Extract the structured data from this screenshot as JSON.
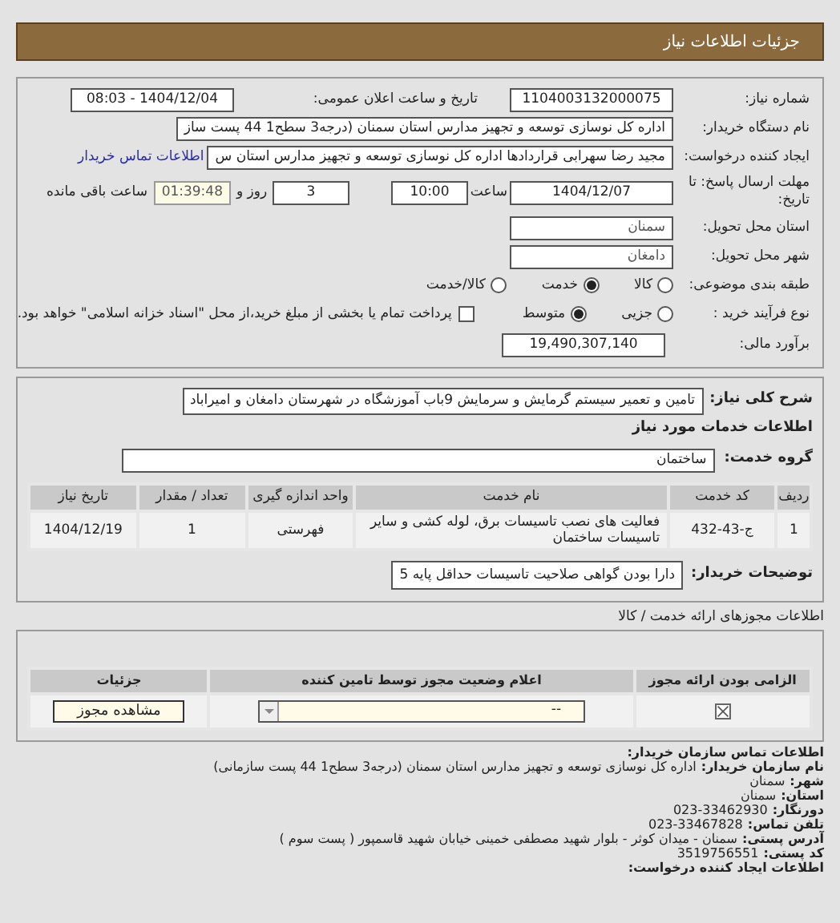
{
  "header": {
    "title": "جزئیات اطلاعات نیاز"
  },
  "summary": {
    "need_number": {
      "label": "شماره نیاز:",
      "value": "1104003132000075"
    },
    "announce": {
      "label": "تاریخ و ساعت اعلان عمومی:",
      "value": "1404/12/04 - 08:03"
    },
    "buyer": {
      "label": "نام دستگاه خریدار:",
      "value": "اداره کل نوسازی   توسعه و تجهیز مدارس استان سمنان (درجه3  سطح1  44 پست ساز"
    },
    "creator": {
      "label": "ایجاد کننده درخواست:",
      "value": "مجید رضا سهرابی قراردادها اداره کل نوسازی   توسعه و تجهیز مدارس استان س",
      "link": "اطلاعات تماس خریدار"
    },
    "deadline": {
      "label": "مهلت ارسال پاسخ: تا تاریخ:",
      "date": "1404/12/07",
      "time_label": "ساعت",
      "time": "10:00",
      "days": "3",
      "days_label": "روز و",
      "remaining": "01:39:48",
      "remaining_label": "ساعت باقی مانده"
    },
    "province": {
      "label": "استان محل تحویل:",
      "value": "سمنان"
    },
    "city": {
      "label": "شهر محل تحویل:",
      "value": "دامغان"
    },
    "category": {
      "label": "طبقه بندی موضوعی:",
      "options": [
        {
          "label": "کالا",
          "selected": false
        },
        {
          "label": "خدمت",
          "selected": true
        },
        {
          "label": "کالا/خدمت",
          "selected": false
        }
      ]
    },
    "purchase_type": {
      "label": "نوع فرآیند خرید :",
      "options": [
        {
          "label": "جزیی",
          "selected": false
        },
        {
          "label": "متوسط",
          "selected": true
        }
      ],
      "treasury": {
        "checked": false,
        "text": "پرداخت تمام یا بخشی از مبلغ خرید،از محل \"اسناد خزانه اسلامی\" خواهد بود."
      }
    },
    "budget": {
      "label": "برآورد مالی:",
      "value": "19,490,307,140"
    }
  },
  "needs": {
    "description": {
      "label": "شرح کلی نیاز:",
      "value": "تامین و تعمیر سیستم گرمایش و سرمایش 9باب آموزشگاه در شهرستان دامغان و امیراباد"
    },
    "services_title": "اطلاعات خدمات مورد نیاز",
    "service_group": {
      "label": "گروه خدمت:",
      "value": "ساختمان"
    },
    "table": {
      "columns": [
        "ردیف",
        "کد خدمت",
        "نام خدمت",
        "واحد اندازه گیری",
        "تعداد / مقدار",
        "تاریخ نیاز"
      ],
      "rows": [
        [
          "1",
          "ج-43-432",
          "فعالیت های نصب تاسیسات برق، لوله کشی و سایر تاسیسات ساختمان",
          "فهرستی",
          "1",
          "1404/12/19"
        ]
      ]
    },
    "buyer_notes": {
      "label": "توضیحات خریدار:",
      "value": "دارا بودن گواهی صلاحیت تاسیسات حداقل پایه 5"
    }
  },
  "licenses": {
    "title": "اطلاعات مجوزهای ارائه خدمت / کالا",
    "columns": [
      "الزامی بودن ارائه مجوز",
      "اعلام وضعیت مجوز توسط تامین کننده",
      "جزئیات"
    ],
    "rows": [
      {
        "required": true,
        "status": "--",
        "button": "مشاهده مجوز"
      }
    ]
  },
  "contact": {
    "title": "اطلاعات تماس سازمان خریدار:",
    "lines": [
      {
        "label": "نام سازمان خریدار:",
        "value": "اداره کل نوسازی توسعه و تجهیز مدارس استان سمنان (درجه3 سطح1 44 پست سازمانی)"
      },
      {
        "label": "شهر:",
        "value": "سمنان"
      },
      {
        "label": "استان:",
        "value": "سمنان"
      },
      {
        "label": "دورنگار:",
        "value": "023-33462930"
      },
      {
        "label": "تلفن تماس:",
        "value": "023-33467828"
      },
      {
        "label": "آدرس پستی:",
        "value": "سمنان - میدان کوثر - بلوار شهید مصطفی خمینی خیابان شهید قاسمپور ( پست سوم )"
      },
      {
        "label": "کد پستی:",
        "value": "3519756551"
      }
    ],
    "footer": "اطلاعات ایجاد کننده درخواست:"
  }
}
